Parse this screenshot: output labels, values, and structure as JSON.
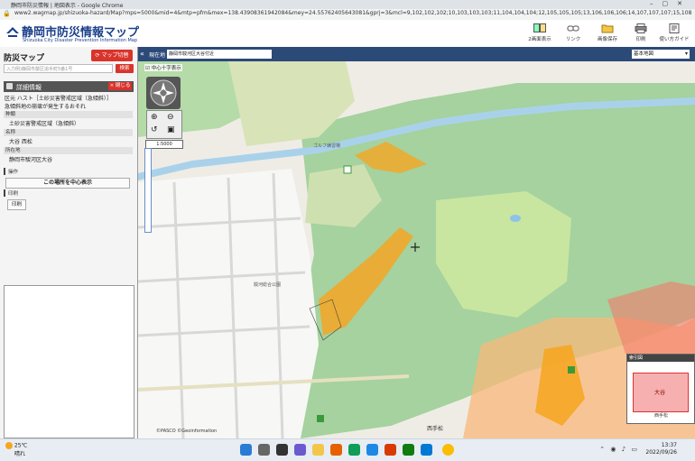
{
  "browser": {
    "tab_title": "静岡市防災情報 | 地図表示 - Google Chrome",
    "url": "www2.wagmap.jp/shizuoka-hazard/Map?mps=5000&mid=4&mtp=pfm&mex=138.43908361942084&mey=24.55762405643081&gprj=3&mcl=9,102,102,102;10,103,103,103;11,104,104,104;12,105,105,105;13,106,106,106;14,107,107,107;15,108,108,108;16,109,1..."
  },
  "app": {
    "title": "静岡市防災情報マップ",
    "subtitle": "Shizuoka City Disaster Prevention Information Map",
    "header_buttons": [
      {
        "label": "2画面表示"
      },
      {
        "label": "リンク"
      },
      {
        "label": "画像保存"
      },
      {
        "label": "印刷"
      },
      {
        "label": "使い方ガイド"
      }
    ]
  },
  "left_panel": {
    "title": "防災マップ",
    "map_button": "マップ切替",
    "search_placeholder": "入力例)静岡市葵区追手町5番1号",
    "search_button": "検索",
    "detail_title": "詳細情報",
    "close_button": "× 閉じる",
    "detail_lines": [
      "区元 ハスト［土砂災害警戒区域（急傾斜）］",
      "急傾斜地の崩壊が発生するおそれ"
    ],
    "sections": [
      {
        "header": "种類",
        "value": "土砂災害警戒区域（急傾斜）"
      },
      {
        "header": "名称",
        "value": "大谷 西松"
      },
      {
        "header": "所在地",
        "value": "静岡市駿河区大谷"
      }
    ],
    "label_operation": "操作",
    "center_button": "この場所を中心表示",
    "label_print": "印刷",
    "print_button": "印刷"
  },
  "map": {
    "current_location_label": "現在地",
    "current_location": "静岡市駿河区大谷付近",
    "basemap_select": "基本地図",
    "show_checkbox": "中心十字表示",
    "scale": "1:5000",
    "place_labels": [
      "ゴルフ練習場",
      "駿河総合公園",
      "西手松",
      "大谷"
    ],
    "minimap_title": "索引図",
    "minimap_labels": [
      "大谷",
      "西手松"
    ],
    "attribution": "©PASCO  ©Geoinformation"
  },
  "taskbar": {
    "weather_temp": "25℃",
    "weather_desc": "晴れ",
    "time": "13:37",
    "date": "2022/09/26"
  },
  "colors": {
    "header_blue": "#1a3f8a",
    "accent_red": "#d9342b",
    "toolbar_navy": "#2c4a78",
    "hazard_orange": "#f5a623",
    "hazard_red": "#e8463a"
  }
}
